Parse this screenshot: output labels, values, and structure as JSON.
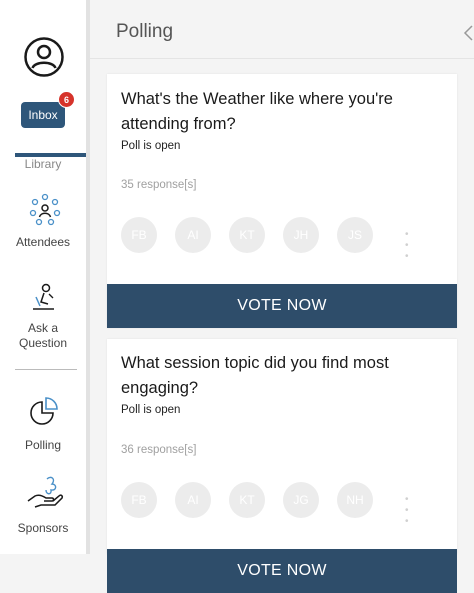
{
  "sidebar": {
    "inbox_label": "Inbox",
    "inbox_badge": "6",
    "library_label": "Library",
    "attendees_label": "Attendees",
    "ask_label_line1": "Ask a",
    "ask_label_line2": "Question",
    "polling_label": "Polling",
    "sponsors_label": "Sponsors"
  },
  "header": {
    "title": "Polling"
  },
  "polls": [
    {
      "question": "What's the Weather like where you're attending from?",
      "status": "Poll is open",
      "responses": "35 response[s]",
      "avatars": [
        "FB",
        "AI",
        "KT",
        "JH",
        "JS"
      ],
      "more": "• • •",
      "button": "VOTE NOW"
    },
    {
      "question": "What session topic did you find most engaging?",
      "status": "Poll is open",
      "responses": "36 response[s]",
      "avatars": [
        "FB",
        "AI",
        "KT",
        "JG",
        "NH"
      ],
      "more": "• • •",
      "button": "VOTE NOW"
    }
  ],
  "colors": {
    "primary": "#2e567a",
    "vote_button": "#2e4d6a",
    "badge": "#d6332b",
    "avatar": "#ececec"
  }
}
